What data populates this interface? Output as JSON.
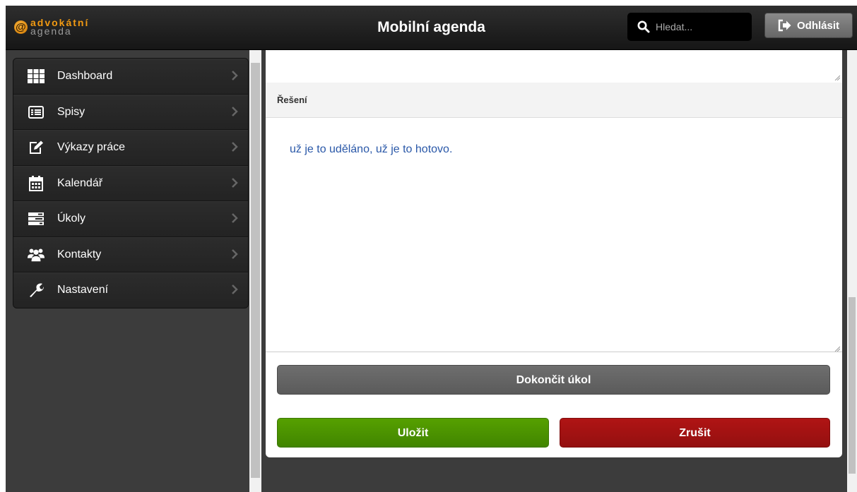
{
  "header": {
    "logo_top": "advokátní",
    "logo_bottom": "agenda",
    "logo_badge": "@",
    "title": "Mobilní agenda",
    "search_placeholder": "Hledat...",
    "logout_label": "Odhlásit"
  },
  "sidebar": {
    "items": [
      {
        "label": "Dashboard",
        "icon": "grid-icon"
      },
      {
        "label": "Spisy",
        "icon": "list-icon"
      },
      {
        "label": "Výkazy práce",
        "icon": "edit-icon"
      },
      {
        "label": "Kalendář",
        "icon": "calendar-icon"
      },
      {
        "label": "Úkoly",
        "icon": "tasks-icon"
      },
      {
        "label": "Kontakty",
        "icon": "users-icon"
      },
      {
        "label": "Nastavení",
        "icon": "wrench-icon"
      }
    ]
  },
  "form": {
    "section_title": "Řešení",
    "resolution_value": "už je to uděláno, už je to hotovo.",
    "finish_label": "Dokončit úkol",
    "save_label": "Uložit",
    "cancel_label": "Zrušit"
  },
  "colors": {
    "save": "#4a9000",
    "cancel": "#a01010",
    "finish": "#666666",
    "text_link": "#2a58a8",
    "logo_orange": "#f29a12"
  }
}
